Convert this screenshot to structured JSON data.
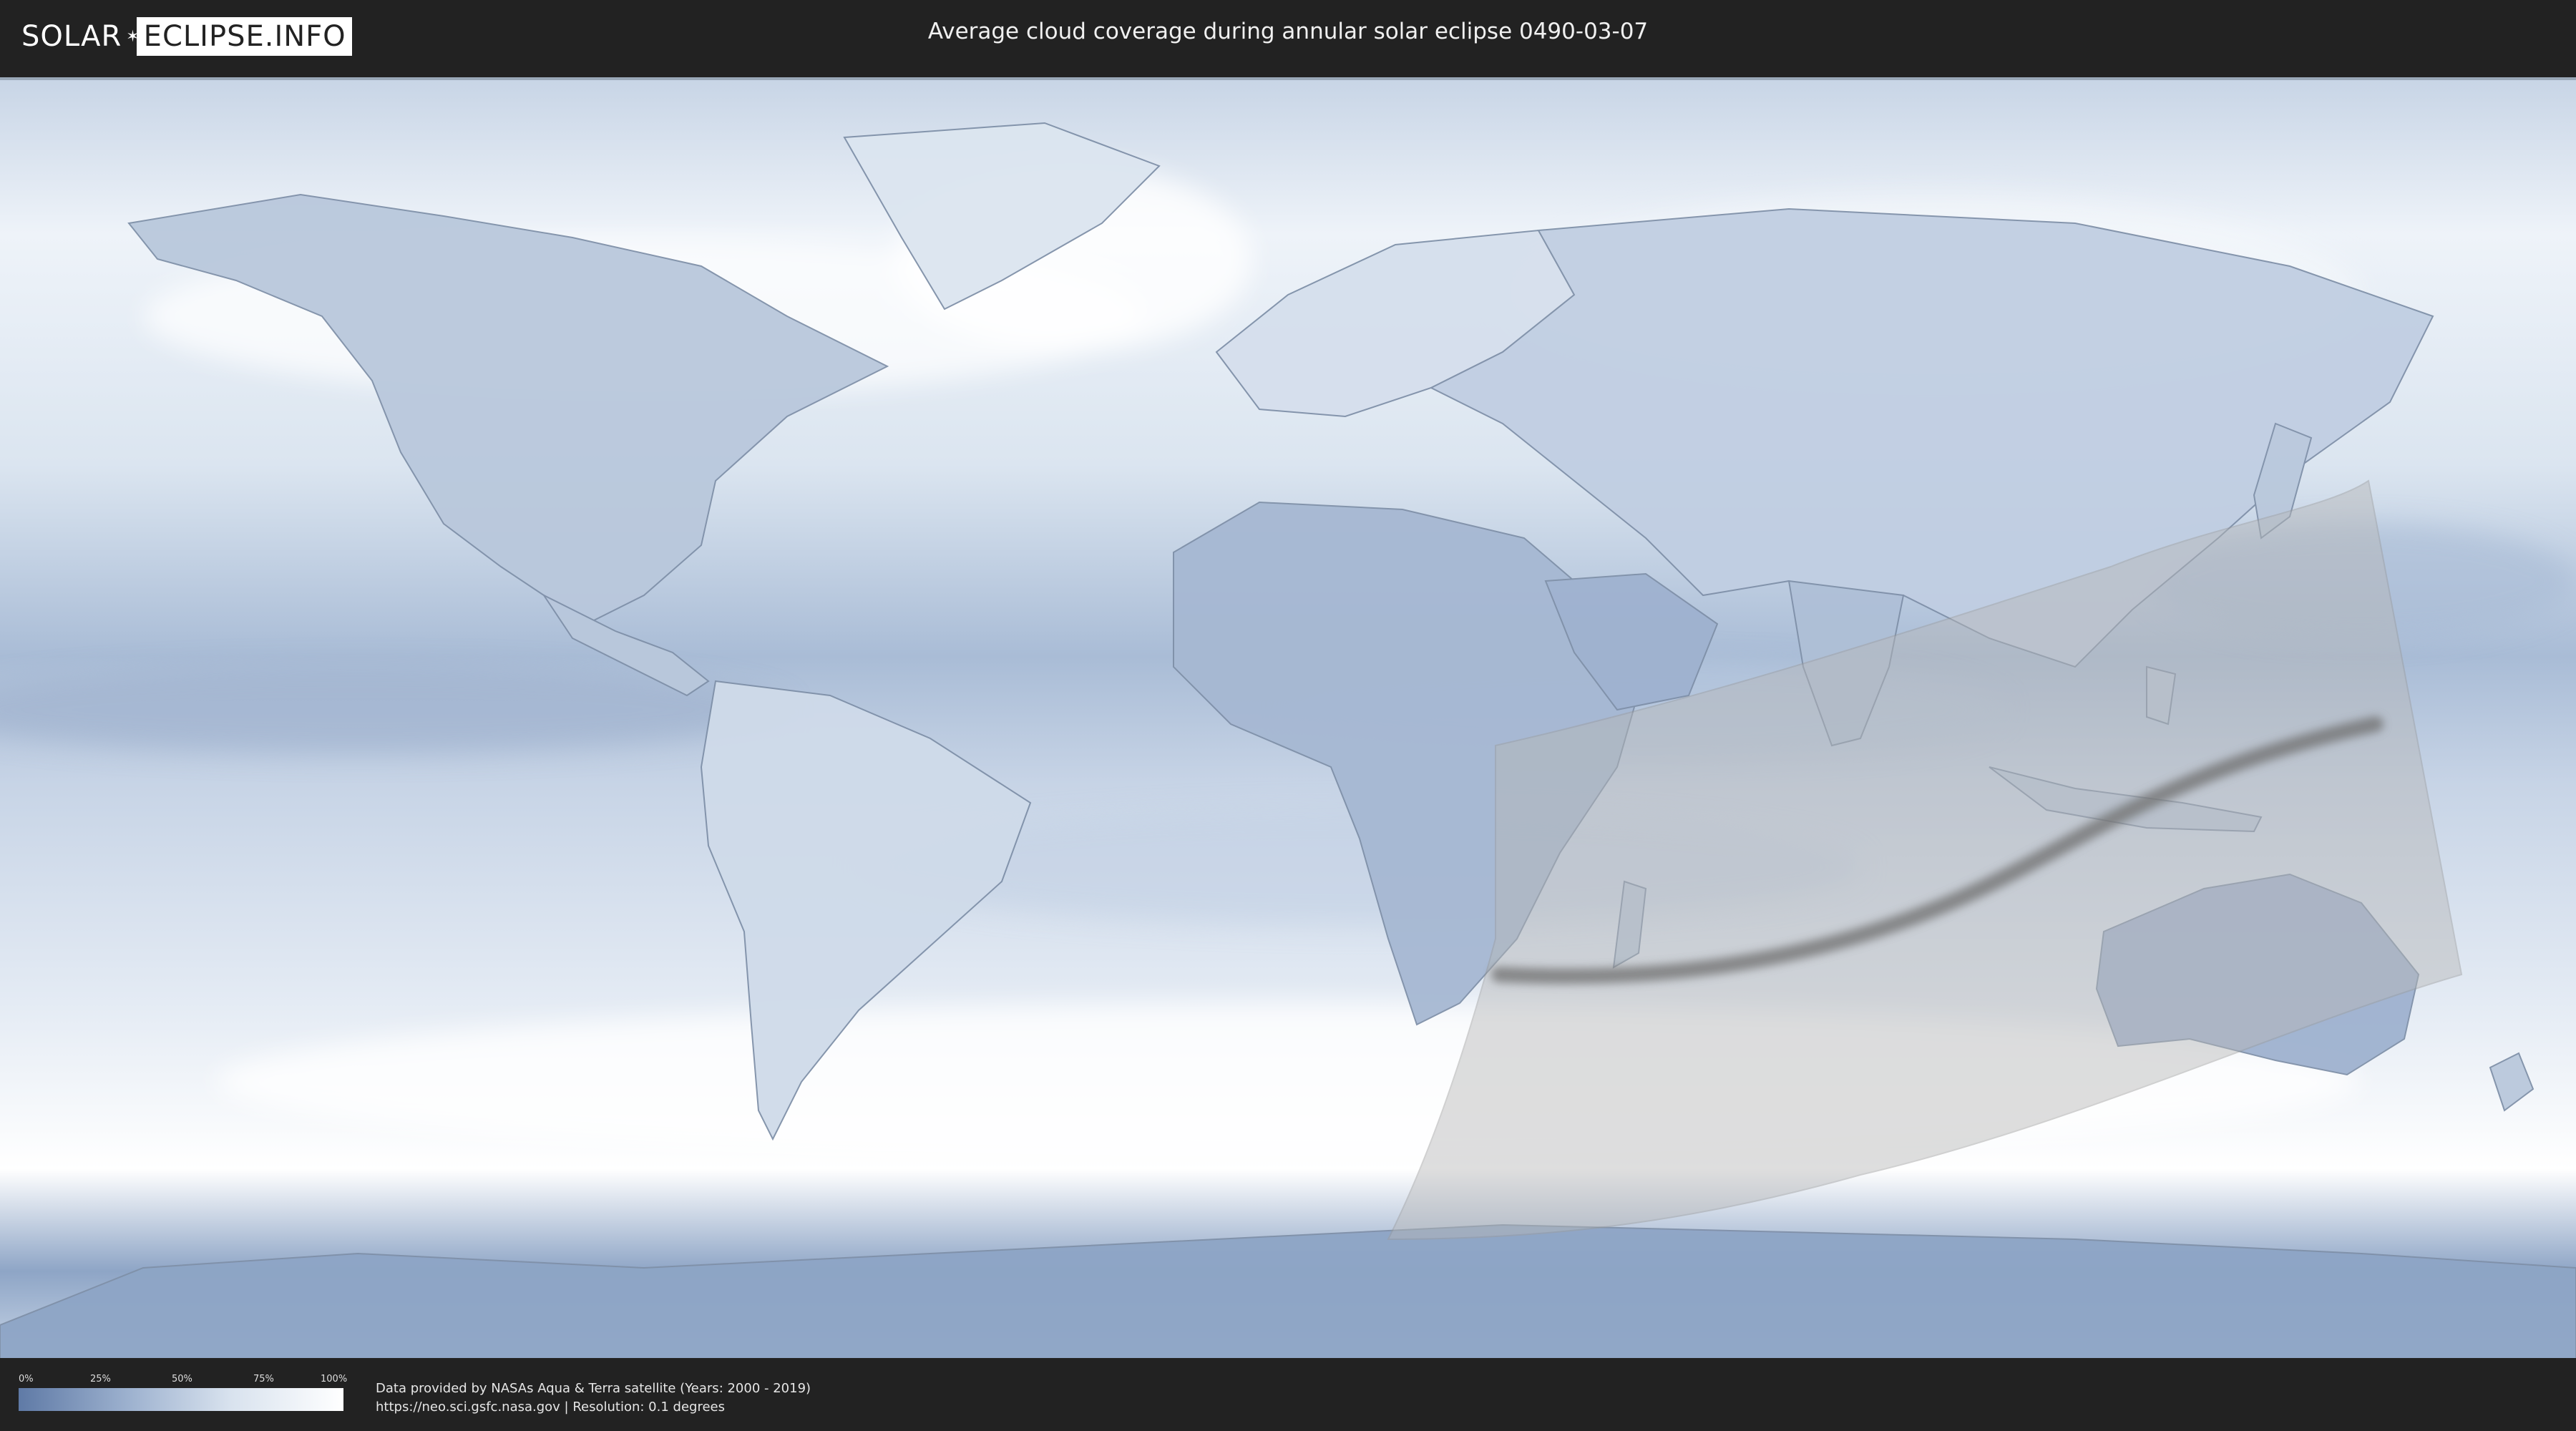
{
  "header": {
    "logo_left": "SOLAR",
    "logo_right": "ECLIPSE.INFO",
    "title": "Average cloud coverage during annular solar eclipse 0490-03-07"
  },
  "legend": {
    "ticks": [
      "0%",
      "25%",
      "50%",
      "75%",
      "100%"
    ],
    "gradient_colors": [
      "#5f7aa6",
      "#9fb3d0",
      "#d8e2ee",
      "#ffffff"
    ]
  },
  "credits": {
    "line1": "Data provided by NASAs Aqua & Terra satellite (Years: 2000 - 2019)",
    "line2": "https://neo.sci.gsfc.nasa.gov | Resolution: 0.1 degrees"
  },
  "map": {
    "cloud_color_low": "#5f7aa6",
    "cloud_color_high": "#ffffff",
    "eclipse_zone_color": "#b5b5b5",
    "central_path_color": "#6f6f6f"
  }
}
